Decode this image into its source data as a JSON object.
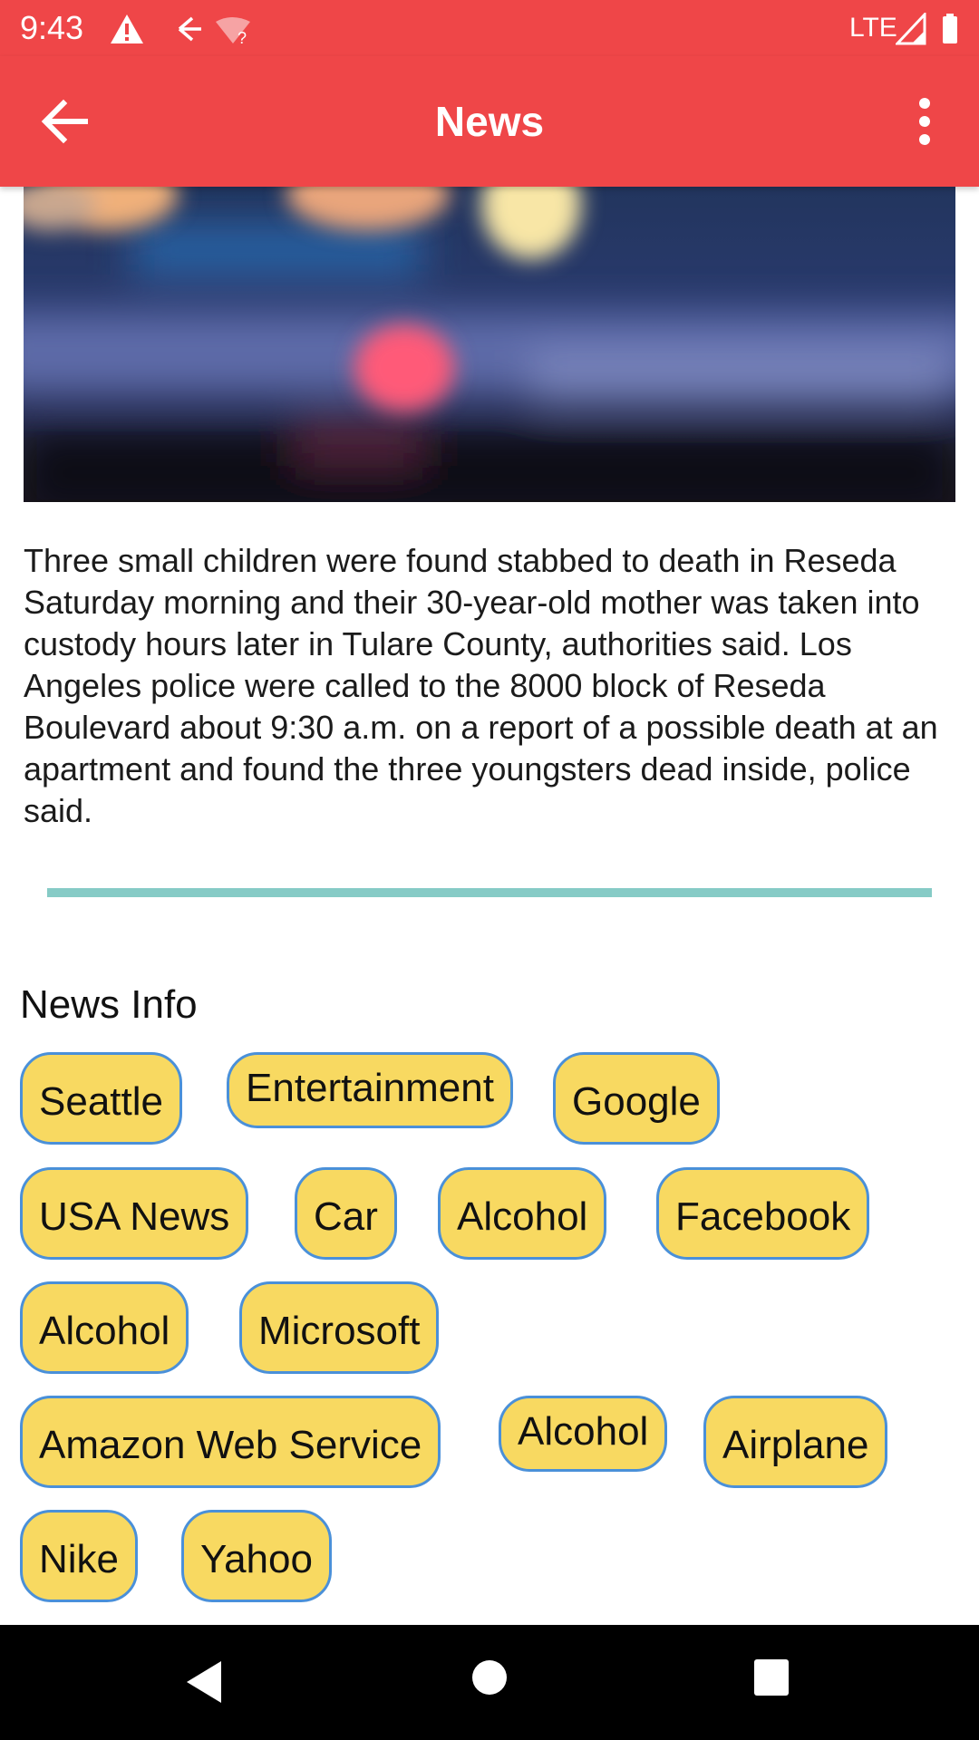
{
  "status_bar": {
    "time": "9:43",
    "network_label": "LTE",
    "icons": [
      "warning-icon",
      "back-arrow-small-icon",
      "wifi-unknown-icon",
      "signal-icon",
      "battery-icon"
    ]
  },
  "app_bar": {
    "title": "News",
    "back_icon": "arrow-back-icon",
    "menu_icon": "more-vert-icon",
    "background_color": "#ef4648"
  },
  "article": {
    "image": "blurred-lights-photo",
    "body": "Three small children were found stabbed to death in Reseda Saturday morning and their 30-year-old mother was taken into custody hours later in Tulare County, authorities said. Los Angeles police were called to the 8000 block of Reseda Boulevard about 9:30 a.m. on a report of a possible death at an apartment and found the three youngsters dead inside, police said."
  },
  "news_info": {
    "title": "News Info",
    "tags": [
      "Seattle",
      "Entertainment",
      "Google",
      "USA News",
      "Car",
      "Alcohol",
      "Facebook",
      "Alcohol",
      "Microsoft",
      "Amazon Web Service",
      "Alcohol",
      "Airplane",
      "Nike",
      "Yahoo"
    ],
    "tag_color": "#f8d961",
    "tag_border_color": "#4a90d9"
  },
  "divider_color": "#86cbc6",
  "nav_bar": {
    "icons": [
      "nav-back-icon",
      "nav-home-icon",
      "nav-recents-icon"
    ]
  }
}
